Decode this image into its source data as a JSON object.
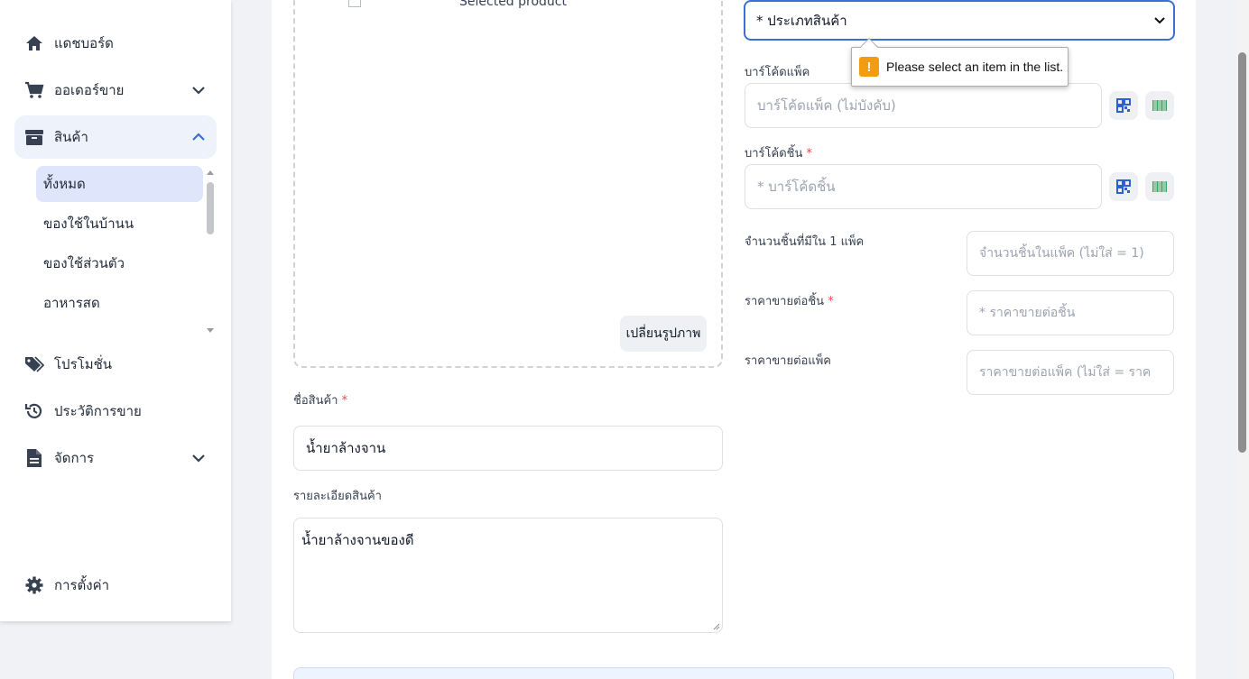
{
  "sidebar": {
    "items": [
      {
        "label": "แดชบอร์ด",
        "icon": "home-icon"
      },
      {
        "label": "ออเดอร์ขาย",
        "icon": "cart-icon"
      },
      {
        "label": "สินค้า",
        "icon": "box-icon"
      },
      {
        "label": "โปรโมชั่น",
        "icon": "tags-icon"
      },
      {
        "label": "ประวัติการขาย",
        "icon": "history-icon"
      },
      {
        "label": "จัดการ",
        "icon": "file-icon"
      },
      {
        "label": "การตั้งค่า",
        "icon": "gear-icon"
      }
    ],
    "submenu": [
      {
        "label": "ทั้งหมด"
      },
      {
        "label": "ของใช้ในบ้านน"
      },
      {
        "label": "ของใช้ส่วนตัว"
      },
      {
        "label": "อาหารสด"
      }
    ],
    "accent": "#3b6fd4"
  },
  "product": {
    "image_alt": "Selected product",
    "change_image_label": "เปลี่ยนรูปภาพ",
    "name_label": "ชื่อสินค้า",
    "name_value": "น้ำยาล้างจาน",
    "desc_label": "รายละเอียดสินค้า",
    "desc_value": "น้ำยาล้างจานของดี",
    "required_mark": "*"
  },
  "form": {
    "category_select": "* ประเภทสินค้า",
    "pack_barcode_label": "บาร์โค้ดแพ็ค",
    "pack_barcode_placeholder": "บาร์โค้ดแพ็ค (ไม่บังคับ)",
    "unit_barcode_label": "บาร์โค้ดชิ้น",
    "unit_barcode_placeholder": "* บาร์โค้ดชิ้น",
    "pack_qty_label": "จำนวนชิ้นที่มีใน 1 แพ็ค",
    "pack_qty_placeholder": "จำนวนชิ้นในแพ็ค (ไม่ใส่ = 1)",
    "unit_price_label": "ราคาขายต่อชิ้น",
    "unit_price_placeholder": "* ราคาขายต่อชิ้น",
    "pack_price_label": "ราคาขายต่อแพ็ค",
    "pack_price_placeholder": "ราคาขายต่อแพ็ค (ไม่ใส่ = ราค"
  },
  "tooltip": {
    "text": "Please select an item in the list.",
    "warn_glyph": "!"
  }
}
